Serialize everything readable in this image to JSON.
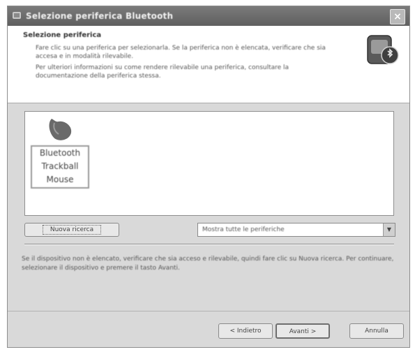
{
  "window": {
    "title": "Selezione periferica Bluetooth",
    "close_glyph": "×"
  },
  "header": {
    "title": "Selezione periferica",
    "description": [
      "Fare clic su una periferica per selezionarla. Se la periferica non è elencata, verificare che sia accesa e in modalità rilevabile.",
      "Per ulteriori informazioni su come rendere rilevabile una periferica, consultare la documentazione della periferica stessa."
    ],
    "icon": "bluetooth-device-icon"
  },
  "devices": [
    {
      "label": "Bluetooth\nTrackball\nMouse",
      "icon": "mouse-icon"
    }
  ],
  "controls": {
    "search_again": "Nuova ricerca",
    "filter_value": "Mostra tutte le periferiche",
    "filter_arrow": "▼"
  },
  "info_text": "Se il dispositivo non è elencato, verificare che sia acceso e rilevabile, quindi fare clic su Nuova ricerca. Per continuare, selezionare il dispositivo e premere il tasto Avanti.",
  "footer": {
    "back": "< Indietro",
    "next": "Avanti >",
    "cancel": "Annulla"
  },
  "colors": {
    "titlebar": "#6b6b6b",
    "dialog_bg": "#d9d9d9",
    "panel_bg": "#ffffff"
  }
}
